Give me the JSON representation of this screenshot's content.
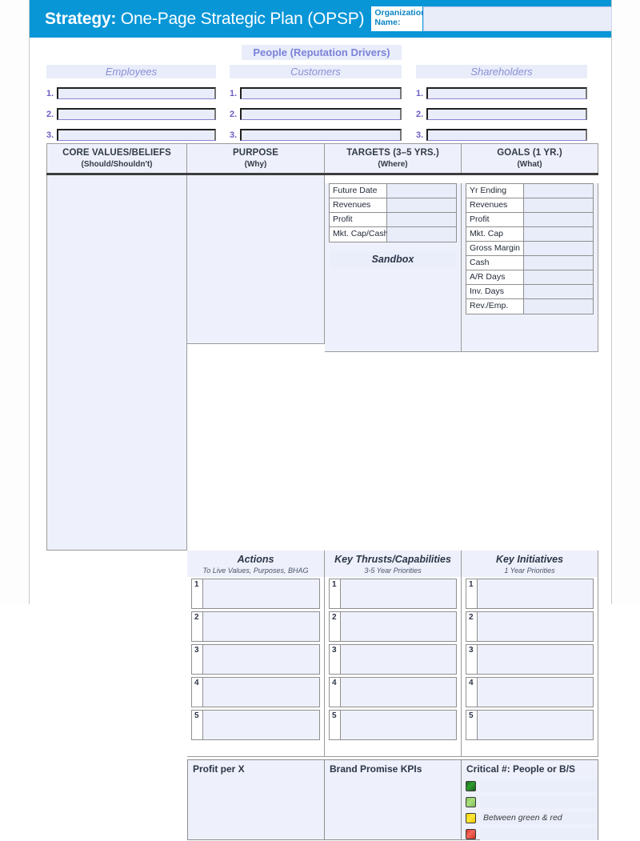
{
  "header": {
    "title_bold": "Strategy:",
    "title_rest": " One-Page Strategic Plan (OPSP)",
    "org_label": "Organization Name:",
    "org_value": "",
    "org_placeholder": "",
    "bg_color": "#0896d7"
  },
  "people": {
    "title": "People (Reputation Drivers)",
    "columns": [
      {
        "heading": "Employees",
        "entries": [
          {
            "num": "1.",
            "value": ""
          },
          {
            "num": "2.",
            "value": ""
          },
          {
            "num": "3.",
            "value": ""
          }
        ]
      },
      {
        "heading": "Customers",
        "entries": [
          {
            "num": "1.",
            "value": ""
          },
          {
            "num": "2.",
            "value": ""
          },
          {
            "num": "3.",
            "value": ""
          }
        ]
      },
      {
        "heading": "Shareholders",
        "entries": [
          {
            "num": "1.",
            "value": ""
          },
          {
            "num": "2.",
            "value": ""
          },
          {
            "num": "3.",
            "value": ""
          }
        ]
      }
    ]
  },
  "columns": {
    "core_values": {
      "title": "CORE VALUES/BELIEFS",
      "subtitle": "(Should/Shouldn't)",
      "value": ""
    },
    "purpose": {
      "title": "PURPOSE",
      "subtitle": "(Why)",
      "value": ""
    },
    "targets": {
      "title": "TARGETS (3–5 YRS.)",
      "subtitle": "(Where)"
    },
    "goals": {
      "title": "GOALS (1 YR.)",
      "subtitle": "(What)"
    }
  },
  "targets_table": {
    "rows": [
      {
        "label": "Future Date",
        "value": ""
      },
      {
        "label": "Revenues",
        "value": ""
      },
      {
        "label": "Profit",
        "value": ""
      },
      {
        "label": "Mkt. Cap/Cash",
        "value": ""
      }
    ],
    "sandbox_label": "Sandbox",
    "sandbox_value": ""
  },
  "goals_table": {
    "rows": [
      {
        "label": "Yr Ending",
        "value": ""
      },
      {
        "label": "Revenues",
        "value": ""
      },
      {
        "label": "Profit",
        "value": ""
      },
      {
        "label": "Mkt. Cap",
        "value": ""
      },
      {
        "label": "Gross Margin",
        "value": ""
      },
      {
        "label": "Cash",
        "value": ""
      },
      {
        "label": "A/R Days",
        "value": ""
      },
      {
        "label": "Inv. Days",
        "value": ""
      },
      {
        "label": "Rev./Emp.",
        "value": ""
      }
    ]
  },
  "mid_sections": [
    {
      "title": "Actions",
      "subtitle": "To Live Values, Purposes, BHAG",
      "items": [
        {
          "num": "1",
          "value": ""
        },
        {
          "num": "2",
          "value": ""
        },
        {
          "num": "3",
          "value": ""
        },
        {
          "num": "4",
          "value": ""
        },
        {
          "num": "5",
          "value": ""
        }
      ]
    },
    {
      "title": "Key Thrusts/Capabilities",
      "subtitle": "3-5 Year Priorities",
      "items": [
        {
          "num": "1",
          "value": ""
        },
        {
          "num": "2",
          "value": ""
        },
        {
          "num": "3",
          "value": ""
        },
        {
          "num": "4",
          "value": ""
        },
        {
          "num": "5",
          "value": ""
        }
      ]
    },
    {
      "title": "Key Initiatives",
      "subtitle": "1 Year Priorities",
      "items": [
        {
          "num": "1",
          "value": ""
        },
        {
          "num": "2",
          "value": ""
        },
        {
          "num": "3",
          "value": ""
        },
        {
          "num": "4",
          "value": ""
        },
        {
          "num": "5",
          "value": ""
        }
      ]
    }
  ],
  "bottom": {
    "profit_per_x": {
      "title": "Profit per X",
      "value": ""
    },
    "brand_promise": {
      "title": "Brand Promise KPIs",
      "value": ""
    },
    "critical_number": {
      "title": "Critical #: People or B/S",
      "rows": [
        {
          "swatch": "dark-green",
          "color": "#2f9e2f",
          "note": "",
          "value": ""
        },
        {
          "swatch": "light-green",
          "color": "#a9dd7c",
          "note": "",
          "value": ""
        },
        {
          "swatch": "yellow",
          "color": "#ffe83a",
          "note": "Between green & red",
          "value": ""
        },
        {
          "swatch": "red",
          "color": "#f2685a",
          "note": "",
          "value": ""
        }
      ]
    }
  }
}
